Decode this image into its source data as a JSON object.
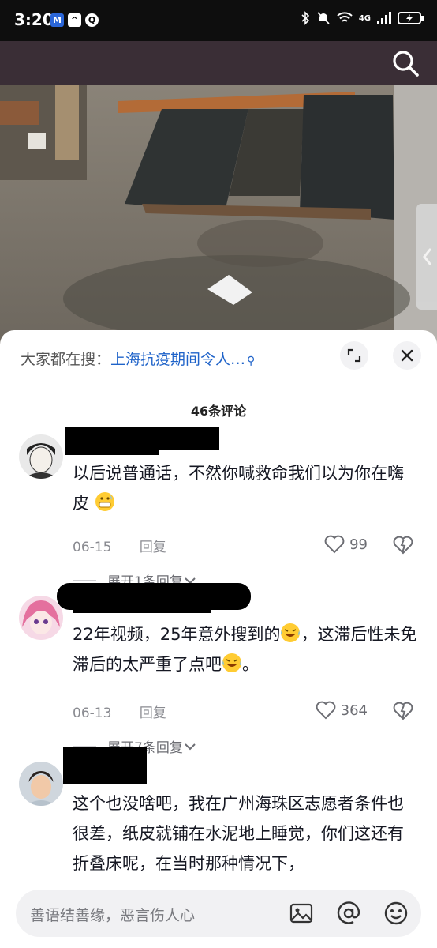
{
  "status_bar": {
    "time": "3:20",
    "network": "4G"
  },
  "search_bar": {
    "prefix": "大家都在搜：",
    "term": "上海抗疫期间令人…",
    "query_icon": "search-small-icon"
  },
  "comment_count": "46条评论",
  "comments": [
    {
      "text": "以后说普通话，不然你喊救命我们以为你在嗨皮",
      "date": "06-15",
      "reply": "回复",
      "likes": "99",
      "expand": "展开1条回复"
    },
    {
      "text_a": "22年视频，25年意外搜到的",
      "text_b": "，这滞后性未免滞后的太严重了点吧",
      "text_c": "。",
      "date": "06-13",
      "reply": "回复",
      "likes": "364",
      "expand": "展开7条回复"
    },
    {
      "text": "这个也没啥吧，我在广州海珠区志愿者条件也很差，纸皮就铺在水泥地上睡觉，你们这还有折叠床呢，在当时那种情况下，"
    }
  ],
  "input": {
    "placeholder": "善语结善缘，恶言伤人心"
  },
  "icons": [
    "search-icon",
    "fullscreen-icon",
    "close-icon",
    "heart-icon",
    "dislike-icon",
    "image-icon",
    "at-icon",
    "emoji-icon",
    "chevron-left-icon"
  ]
}
